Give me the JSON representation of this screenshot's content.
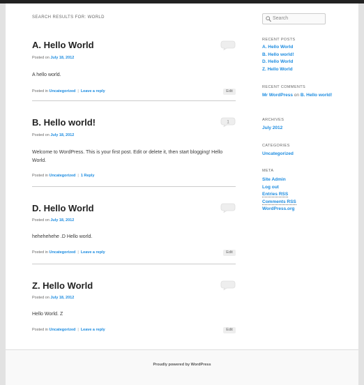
{
  "search_title": "SEARCH RESULTS FOR: WORLD",
  "posts": [
    {
      "title": "A. Hello World",
      "posted_on": "Posted on",
      "date": "July 18, 2012",
      "body": "A hello world.",
      "posted_in": "Posted in",
      "category": "Uncategorized",
      "reply": "Leave a reply",
      "edit": "Edit",
      "comments": ""
    },
    {
      "title": "B. Hello world!",
      "posted_on": "Posted on",
      "date": "July 18, 2012",
      "body": "Welcome to WordPress. This is your first post. Edit or delete it, then start blogging! Hello World.",
      "posted_in": "Posted in",
      "category": "Uncategorized",
      "reply": "1 Reply",
      "edit": "",
      "comments": "1"
    },
    {
      "title": "D. Hello World",
      "posted_on": "Posted on",
      "date": "July 18, 2012",
      "body": "hehehehehe .D Hello world.",
      "posted_in": "Posted in",
      "category": "Uncategorized",
      "reply": "Leave a reply",
      "edit": "Edit",
      "comments": ""
    },
    {
      "title": "Z. Hello World",
      "posted_on": "Posted on",
      "date": "July 18, 2012",
      "body": "Hello World. Z",
      "posted_in": "Posted in",
      "category": "Uncategorized",
      "reply": "Leave a reply",
      "edit": "Edit",
      "comments": ""
    }
  ],
  "sidebar": {
    "search_placeholder": "Search",
    "recent_posts_title": "RECENT POSTS",
    "recent_posts": [
      "A. Hello World",
      "B. Hello world!",
      "D. Hello World",
      "Z. Hello World"
    ],
    "recent_comments_title": "RECENT COMMENTS",
    "recent_comment": {
      "author": "Mr WordPress",
      "on": "on",
      "post": "B. Hello world!"
    },
    "archives_title": "ARCHIVES",
    "archives": [
      "July 2012"
    ],
    "categories_title": "CATEGORIES",
    "categories": [
      "Uncategorized"
    ],
    "meta_title": "META",
    "meta": [
      "Site Admin",
      "Log out",
      "Entries RSS",
      "Comments RSS",
      "WordPress.org"
    ]
  },
  "footer": {
    "text": "Proudly powered by WordPress"
  },
  "colors": {
    "link": "#1b8be0",
    "top_bar": "#222222",
    "background": "#e2e2e2"
  },
  "icons": {
    "comment_bubble": "speech-bubble-icon",
    "search": "magnifier-icon"
  }
}
